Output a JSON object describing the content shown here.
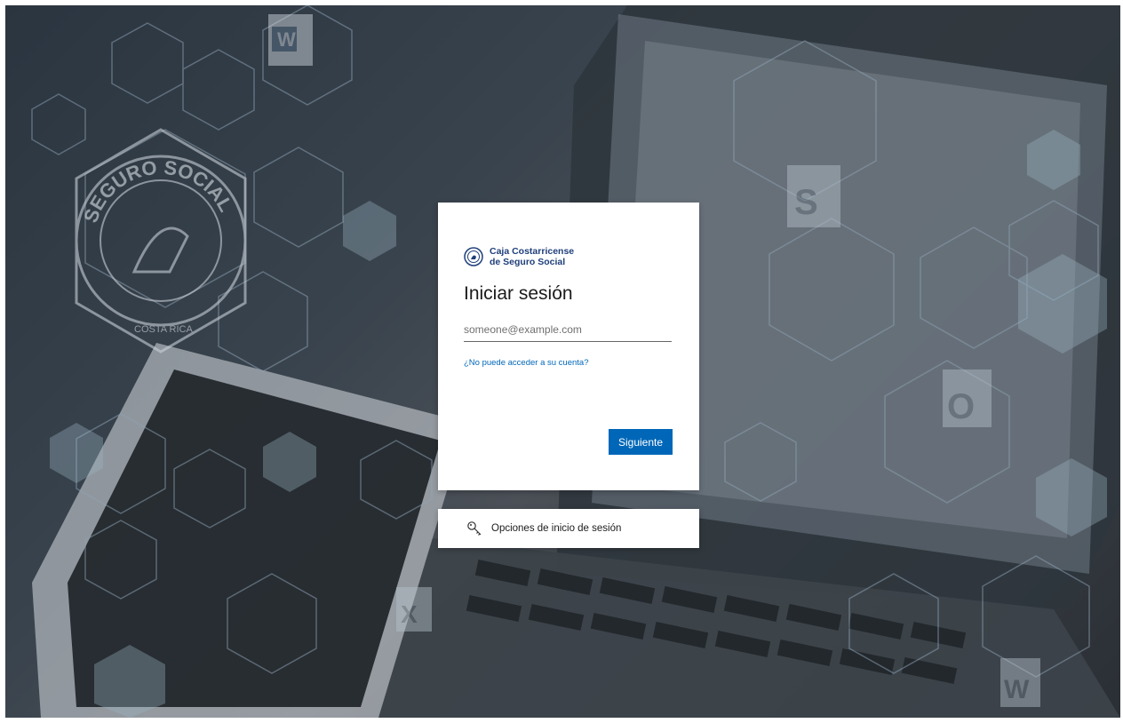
{
  "background": {
    "seal": {
      "text_top": "SEGURO SOCIAL",
      "text_bottom": "COSTA RICA"
    },
    "theme_colors": {
      "overlay": "#2b3540",
      "hex_line": "#8fa3b5"
    }
  },
  "signin": {
    "org_name_line1": "Caja Costarricense",
    "org_name_line2": "de Seguro Social",
    "title": "Iniciar sesión",
    "email_placeholder": "someone@example.com",
    "email_value": "",
    "cant_access_link": "¿No puede acceder a su cuenta?",
    "next_button": "Siguiente",
    "accent_color": "#0067b8"
  },
  "signin_options": {
    "label": "Opciones de inicio de sesión",
    "icon": "key-icon"
  }
}
